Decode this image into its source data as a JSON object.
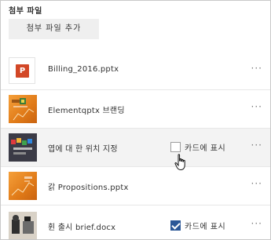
{
  "panel": {
    "title": "첨부 파일",
    "add_button_label": "첨부 파일 추가"
  },
  "attachments": [
    {
      "name": "Billing_2016.pptx",
      "thumbnail": "powerpoint-file-icon",
      "show_card": null,
      "more_label": "···"
    },
    {
      "name": "Elementqptx 브랜딩",
      "thumbnail": "orange-slide-thumbnail",
      "show_card": null,
      "more_label": "···"
    },
    {
      "name": "엽에 대 한 위치 지정",
      "thumbnail": "dark-slide-thumbnail",
      "show_card": false,
      "card_label": "카드에 표시",
      "more_label": "···"
    },
    {
      "name": "갉 Propositions.pptx",
      "thumbnail": "orange-slide-thumbnail",
      "show_card": null,
      "more_label": "···"
    },
    {
      "name": "휜 출시 brief.docx",
      "thumbnail": "photo-document-thumbnail",
      "show_card": true,
      "card_label": "카드에 표시",
      "more_label": "···"
    }
  ],
  "ppt_icon_letter": "P",
  "colors": {
    "ppt_red": "#d24726",
    "checkbox_checked": "#2b5797",
    "hover_row": "#f3f3f3"
  },
  "cursor": "hand-pointer-cursor"
}
